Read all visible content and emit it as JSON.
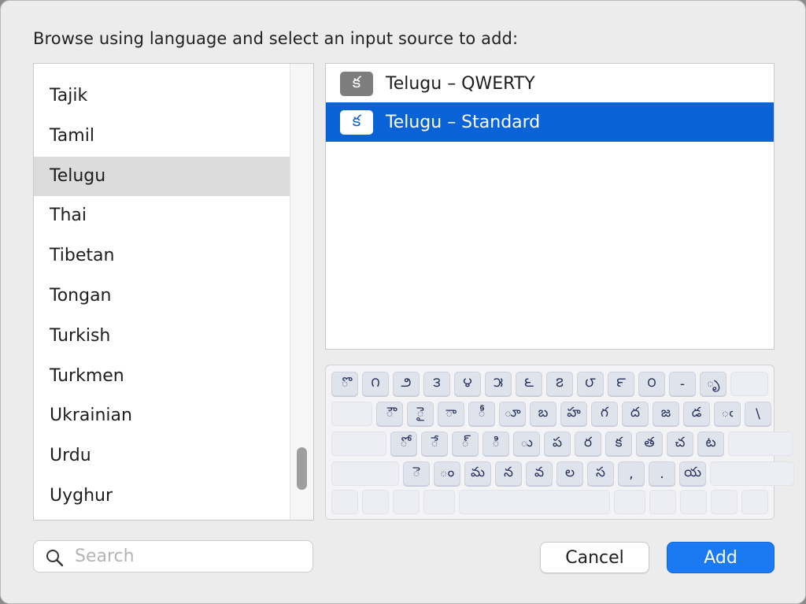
{
  "prompt": "Browse using language and select an input source to add:",
  "languages": [
    {
      "label": "Tajik"
    },
    {
      "label": "Tamil"
    },
    {
      "label": "Telugu",
      "selected": true
    },
    {
      "label": "Thai"
    },
    {
      "label": "Tibetan"
    },
    {
      "label": "Tongan"
    },
    {
      "label": "Turkish"
    },
    {
      "label": "Turkmen"
    },
    {
      "label": "Ukrainian"
    },
    {
      "label": "Urdu"
    },
    {
      "label": "Uyghur"
    }
  ],
  "sources": [
    {
      "badge": "క",
      "label": "Telugu – QWERTY"
    },
    {
      "badge": "క",
      "label": "Telugu – Standard",
      "selected": true
    }
  ],
  "keyboard": {
    "row1": [
      "ొ",
      "౧",
      "౨",
      "౩",
      "౪",
      "౫",
      "౬",
      "౭",
      "౮",
      "౯",
      "౦",
      "-",
      "ృ",
      ""
    ],
    "row2": [
      "",
      "ౌ",
      "ై",
      "ా",
      "ీ",
      "ూ",
      "బ",
      "హ",
      "గ",
      "ద",
      "జ",
      "డ",
      "ఁ",
      "\\"
    ],
    "row3": [
      "",
      "ో",
      "ే",
      "్",
      "ి",
      "ు",
      "ప",
      "ర",
      "క",
      "త",
      "చ",
      "ట",
      ""
    ],
    "row4": [
      "",
      "ె",
      "ం",
      "మ",
      "న",
      "వ",
      "ల",
      "స",
      ",",
      ".",
      "య",
      ""
    ]
  },
  "search": {
    "placeholder": "Search",
    "value": ""
  },
  "buttons": {
    "cancel": "Cancel",
    "add": "Add"
  },
  "colors": {
    "selection": "#0a63d6",
    "accent": "#1a79f3",
    "row_highlight": "#dcdcdc"
  }
}
